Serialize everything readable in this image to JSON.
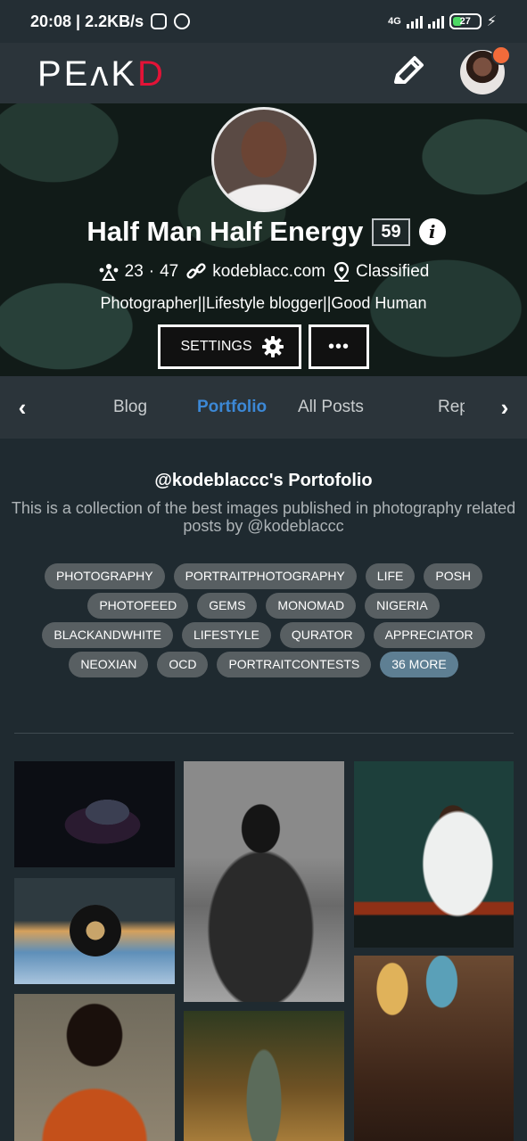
{
  "status_bar": {
    "time_speed": "20:08 | 2.2KB/s",
    "network_label": "4G",
    "battery": "27"
  },
  "header": {
    "logo_part1": "PE",
    "logo_part2": "ʌK",
    "logo_part3": "D"
  },
  "profile": {
    "name": "Half Man Half Energy",
    "reputation": "59",
    "followers": "23",
    "following": "47",
    "website": "kodeblacc.com",
    "location": "Classified",
    "bio": "Photographer||Lifestyle blogger||Good Human",
    "settings_label": "SETTINGS",
    "more_label": "•••"
  },
  "tabs": {
    "items": [
      "Blog",
      "Portfolio",
      "All Posts",
      "Rep"
    ],
    "active": "Portfolio"
  },
  "portfolio": {
    "title": "@kodeblaccc's Portofolio",
    "description": "This is a collection of the best images published in photography related posts by @kodeblaccc",
    "tags": [
      "PHOTOGRAPHY",
      "PORTRAITPHOTOGRAPHY",
      "LIFE",
      "POSH",
      "PHOTOFEED",
      "GEMS",
      "MONOMAD",
      "NIGERIA",
      "BLACKANDWHITE",
      "LIFESTYLE",
      "QURATOR",
      "APPRECIATOR",
      "NEOXIAN",
      "OCD",
      "PORTRAITCONTESTS"
    ],
    "more_tags": "36 MORE"
  },
  "colors": {
    "brand_red": "#e31337",
    "active_tab": "#3c88d6",
    "notification": "#f26b3a"
  }
}
